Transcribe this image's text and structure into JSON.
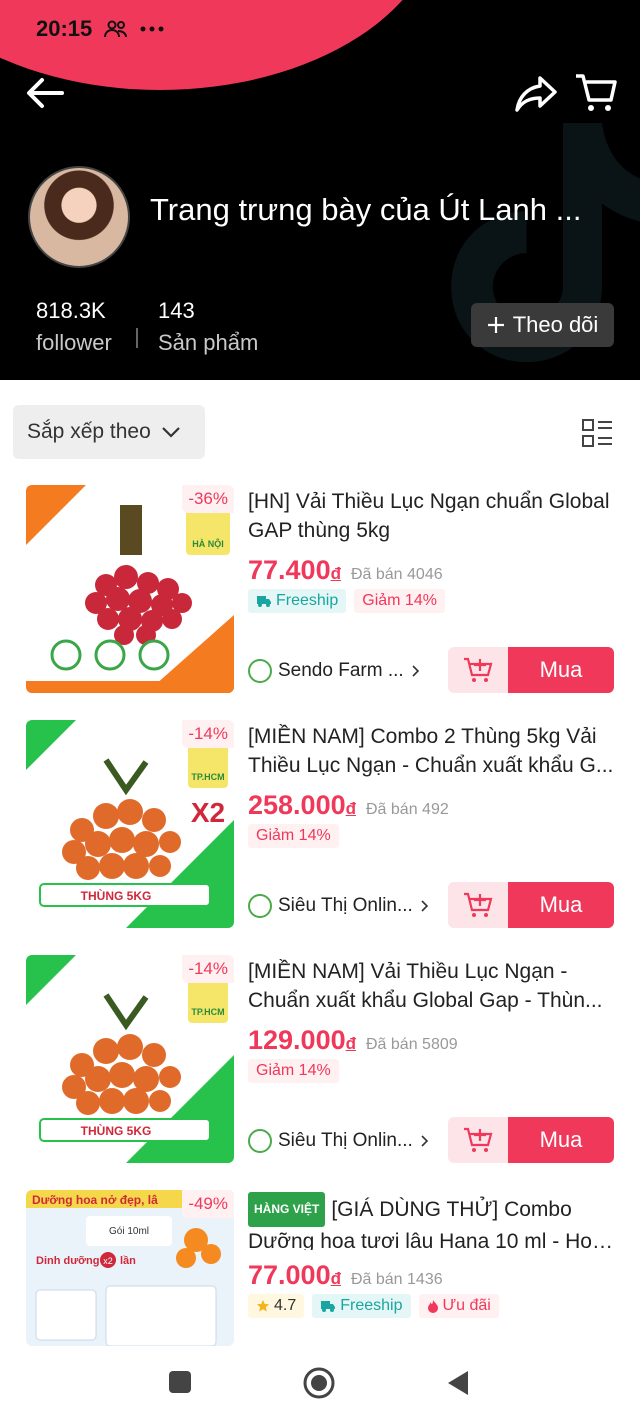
{
  "status_bar": {
    "time": "20:15",
    "icons": [
      "people-icon",
      "more-dots-icon"
    ]
  },
  "header": {
    "shop_name": "Trang trưng bày của Út Lanh ...",
    "followers_value": "818.3K",
    "followers_label": "follower",
    "products_value": "143",
    "products_label": "Sản phẩm",
    "follow_label": "Theo dõi"
  },
  "toolbar": {
    "sort_label": "Sắp xếp theo"
  },
  "colors": {
    "accent": "#f0395a",
    "header_bg": "#000000",
    "freeship": "#1aa6a0",
    "hang_viet": "#2da24a"
  },
  "products": [
    {
      "title_line1": "[HN] Vải Thiều Lục Ngạn chuẩn Global",
      "title_line2": "GAP thùng 5kg",
      "price": "77.400",
      "currency": "đ",
      "sold": "Đã bán 4046",
      "discount_badge": "-36%",
      "freeship": "Freeship",
      "discount_tag": "Giảm 14%",
      "shop": "Sendo Farm ...",
      "buy_label": "Mua",
      "region": "HÀ NỘI"
    },
    {
      "title_line1": "[MIỀN NAM] Combo 2 Thùng 5kg Vải",
      "title_line2": "Thiều Lục Ngạn - Chuẩn xuất khẩu G...",
      "price": "258.000",
      "currency": "đ",
      "sold": "Đã bán 492",
      "discount_badge": "-14%",
      "discount_tag": "Giảm 14%",
      "shop": "Siêu Thị Onlin...",
      "buy_label": "Mua",
      "region": "TP.HCM",
      "multiplier": "X2",
      "box_label": "THÙNG 5KG"
    },
    {
      "title_line1": "[MIỀN NAM] Vải Thiều Lục Ngạn -",
      "title_line2": "Chuẩn xuất khẩu Global Gap - Thùn...",
      "price": "129.000",
      "currency": "đ",
      "sold": "Đã bán 5809",
      "discount_badge": "-14%",
      "discount_tag": "Giảm 14%",
      "shop": "Siêu Thị Onlin...",
      "buy_label": "Mua",
      "region": "TP.HCM",
      "box_label": "THÙNG 5KG"
    },
    {
      "badge": "HÀNG VIỆT",
      "title_line1": "[GIÁ DÙNG THỬ] Combo",
      "title_line2": "Dưỡng hoa tươi lâu Hana 10 ml - Hoa...",
      "price": "77.000",
      "currency": "đ",
      "sold": "Đã bán 1436",
      "discount_badge": "-49%",
      "rating": "4.7",
      "freeship": "Freeship",
      "promo_tag": "Ưu đãi",
      "thumb_text": "Dưỡng hoa nở đẹp, lâ",
      "thumb_gift": "Gói 10ml",
      "thumb_dd": "Dinh dưỡng",
      "thumb_x2": "x2",
      "thumb_lan": "lần"
    }
  ]
}
